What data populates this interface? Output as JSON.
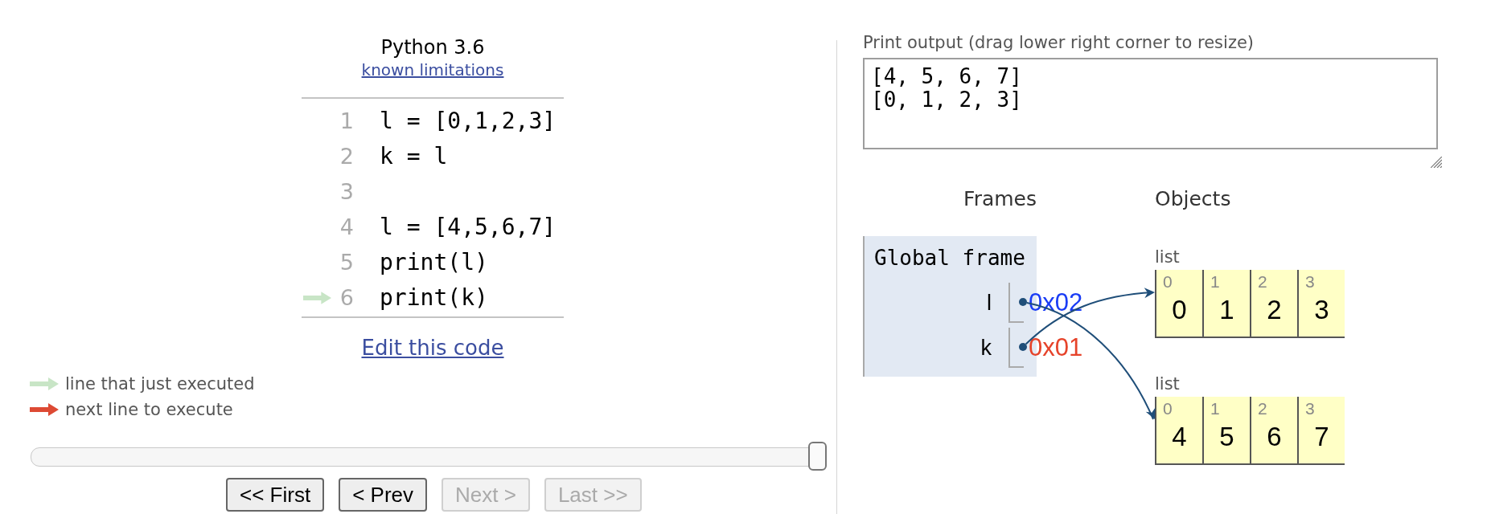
{
  "header": {
    "language": "Python 3.6",
    "link": "known limitations"
  },
  "code": {
    "lines": [
      {
        "number": "1",
        "text": "l = [0,1,2,3]",
        "just_executed": false
      },
      {
        "number": "2",
        "text": "k = l",
        "just_executed": false
      },
      {
        "number": "3",
        "just_executed": false
      },
      {
        "number": "4",
        "text": "l = [4,5,6,7]",
        "just_executed": false
      },
      {
        "number": "5",
        "text": "print(l)",
        "just_executed": false
      },
      {
        "number": "6",
        "text": "print(k)",
        "just_executed": true
      }
    ],
    "edit_link": "Edit this code"
  },
  "legend": [
    {
      "kind": "executed",
      "label": "line that just executed"
    },
    {
      "kind": "next",
      "label": "next line to execute"
    }
  ],
  "slider": {
    "level": 1
  },
  "buttons": [
    {
      "label": "<< First",
      "disabled": false
    },
    {
      "label": "< Prev",
      "disabled": false
    },
    {
      "label": "Next >",
      "disabled": true
    },
    {
      "label": "Last >>",
      "disabled": true
    }
  ],
  "print_output": {
    "label": "Print output (drag lower right corner to resize)",
    "lines": [
      "[4, 5, 6, 7]",
      "[0, 1, 2, 3]"
    ]
  },
  "frames": {
    "heading": "Frames",
    "items": [
      {
        "title": "Global frame",
        "variables": [
          {
            "name": "l",
            "value": "0x02",
            "color": "#1a3cf5",
            "kind": "second"
          },
          {
            "name": "k",
            "value": "0x01",
            "color": "#e6432a",
            "kind": "first"
          }
        ]
      }
    ]
  },
  "objects": {
    "heading": "Objects",
    "items": [
      {
        "kind": "list",
        "label": "list",
        "elements": [
          {
            "index": "0",
            "value": "0"
          },
          {
            "index": "1",
            "value": "1"
          },
          {
            "index": "2",
            "value": "2"
          },
          {
            "index": "3",
            "value": "3"
          }
        ]
      },
      {
        "kind": "list",
        "label": "list",
        "elements": [
          {
            "index": "0",
            "value": "4"
          },
          {
            "index": "1",
            "value": "5"
          },
          {
            "index": "2",
            "value": "6"
          },
          {
            "index": "3",
            "value": "7"
          }
        ]
      }
    ]
  }
}
